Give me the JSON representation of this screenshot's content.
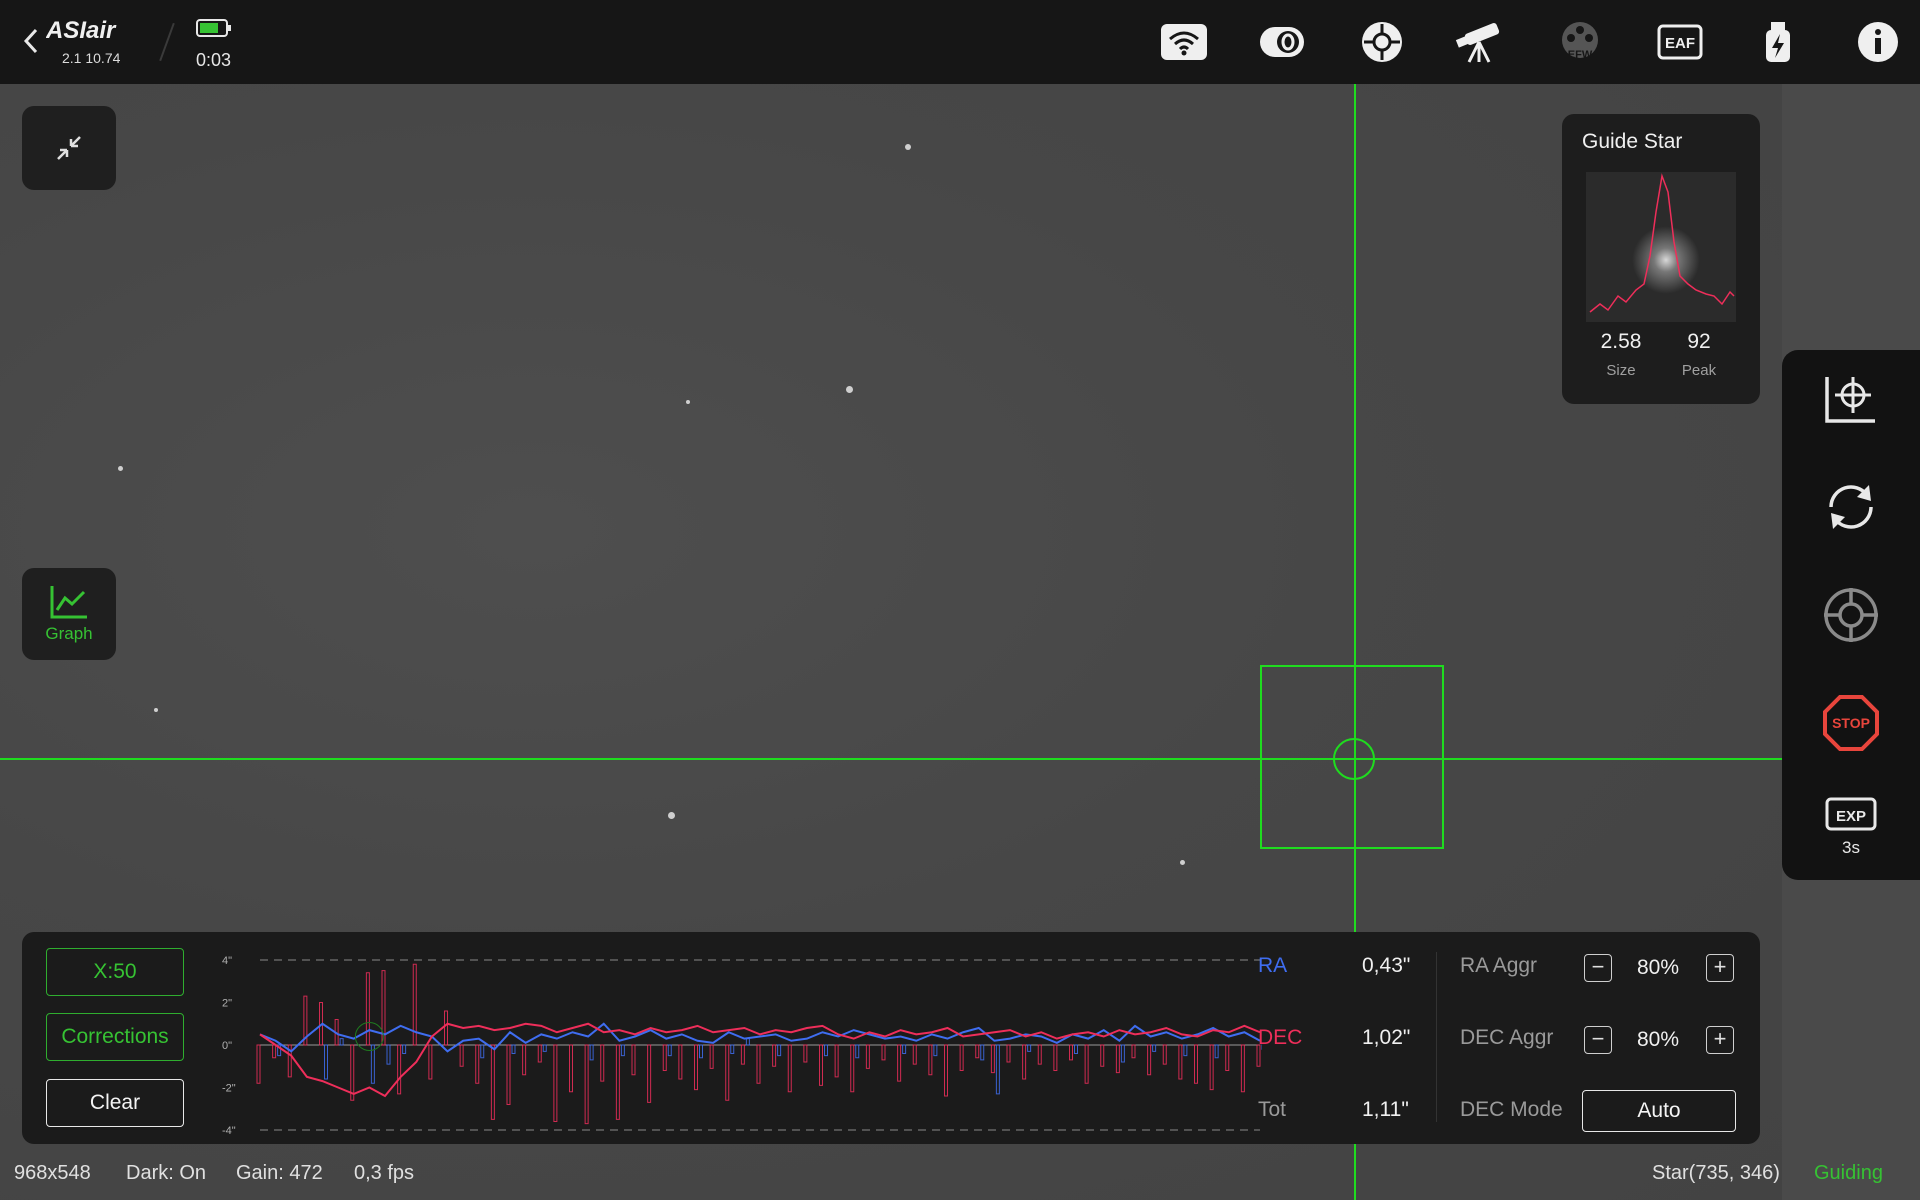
{
  "app": {
    "logo_text": "ASIair",
    "version": "2.1 10.74",
    "elapsed": "0:03",
    "colors": {
      "accent_green": "#36c233",
      "crosshair": "#1fdc1f",
      "ra": "#3f6df0",
      "dec": "#ee2e5a",
      "stop": "#e8453c"
    }
  },
  "toolbar_icons": [
    "wifi-icon",
    "camera-icon",
    "guide-icon",
    "telescope-icon",
    "efw-icon",
    "eaf-icon",
    "usb-power-icon",
    "info-icon"
  ],
  "toolbar_text": {
    "efw": "EFW",
    "eaf": "EAF"
  },
  "left_buttons": {
    "graph_label": "Graph"
  },
  "guide_star": {
    "title": "Guide Star",
    "size_value": "2.58",
    "size_label": "Size",
    "peak_value": "92",
    "peak_label": "Peak"
  },
  "right_toolbar": {
    "stop_label": "STOP",
    "exp_icon_text": "EXP",
    "exposure": "3s"
  },
  "graph_panel": {
    "scale_button": "X:50",
    "corrections_button": "Corrections",
    "clear_button": "Clear",
    "y_ticks": [
      "4\"",
      "2\"",
      "0\"",
      "-2\"",
      "-4\""
    ],
    "ra_label": "RA",
    "ra_value": "0,43\"",
    "dec_label": "DEC",
    "dec_value": "1,02\"",
    "tot_label": "Tot",
    "tot_value": "1,11\"",
    "ra_aggr_label": "RA Aggr",
    "ra_aggr_value": "80%",
    "dec_aggr_label": "DEC Aggr",
    "dec_aggr_value": "80%",
    "dec_mode_label": "DEC Mode",
    "dec_mode_value": "Auto",
    "minus": "−",
    "plus": "+"
  },
  "chart_data": {
    "type": "line",
    "ylim": [
      -4,
      4
    ],
    "series": [
      {
        "name": "RA",
        "values": [
          0.5,
          0.2,
          -0.3,
          0.4,
          1.0,
          0.5,
          0.3,
          0.7,
          0.5,
          0.9,
          0.6,
          0.4,
          -0.3,
          0.2,
          0.3,
          -0.2,
          0.6,
          0.1,
          0.5,
          0.3,
          0.6,
          0.4,
          1.0,
          0.2,
          0.4,
          0.7,
          0.3,
          0.5,
          0.2,
          0.1,
          0.6,
          0.3,
          0.4,
          0.5,
          0.2,
          0.3,
          0.6,
          0.4,
          0.7,
          0.5,
          0.3,
          0.4,
          0.2,
          0.5,
          0.3,
          0.6,
          0.8,
          0.2,
          0.3,
          0.5,
          0.4,
          0.1,
          0.5,
          0.3,
          0.7,
          0.2,
          0.9,
          0.4,
          0.6,
          0.3,
          0.5,
          0.8,
          0.4,
          0.6,
          0.2
        ]
      },
      {
        "name": "DEC",
        "values": [
          0.5,
          0.0,
          -0.5,
          -1.5,
          -1.7,
          -2.0,
          -2.3,
          -2.0,
          -2.4,
          -1.5,
          -0.8,
          0.4,
          1.0,
          0.8,
          0.9,
          0.7,
          0.8,
          1.0,
          0.9,
          0.6,
          0.8,
          1.0,
          0.6,
          0.7,
          0.5,
          0.8,
          0.6,
          0.7,
          0.9,
          0.6,
          0.7,
          0.8,
          0.5,
          0.7,
          0.6,
          0.8,
          0.9,
          0.5,
          0.3,
          0.6,
          0.4,
          0.7,
          0.5,
          0.6,
          0.8,
          0.4,
          0.5,
          0.6,
          0.7,
          0.4,
          0.6,
          0.3,
          0.5,
          0.6,
          0.4,
          0.7,
          0.5,
          0.6,
          0.8,
          0.5,
          0.4,
          0.7,
          0.6,
          0.9,
          0.6
        ]
      }
    ],
    "corrections": {
      "ra": [
        0,
        -0.5,
        0,
        0,
        -1.6,
        0.3,
        0,
        -1.8,
        -0.9,
        -0.4,
        0,
        0,
        0,
        0,
        -0.6,
        0,
        -0.4,
        0,
        -0.3,
        0,
        0,
        -0.7,
        0,
        -0.5,
        0,
        0,
        -0.5,
        0,
        -0.6,
        0,
        -0.4,
        0.3,
        0,
        -0.5,
        0,
        0,
        -0.5,
        0,
        -0.6,
        0,
        0,
        -0.4,
        0,
        -0.5,
        0,
        0,
        -0.7,
        -2.3,
        0,
        -0.3,
        0,
        0,
        -0.4,
        0,
        0,
        -0.8,
        0,
        -0.3,
        0,
        -0.5,
        0,
        -0.6,
        0,
        0,
        -0.2
      ],
      "dec": [
        -1.8,
        -0.6,
        -1.5,
        2.3,
        2.0,
        1.2,
        -2.6,
        3.4,
        3.5,
        -2.3,
        3.8,
        -1.6,
        1.6,
        -1.0,
        -1.8,
        -3.5,
        -2.8,
        -1.4,
        -0.8,
        -3.6,
        -2.2,
        -3.7,
        -1.7,
        -3.5,
        -1.4,
        -2.7,
        -1.2,
        -1.6,
        -2.1,
        -1.1,
        -2.6,
        -0.9,
        -1.8,
        -1.0,
        -2.2,
        -0.8,
        -1.9,
        -1.5,
        -2.2,
        -1.1,
        -0.7,
        -1.7,
        -0.9,
        -1.4,
        -2.4,
        -1.2,
        -0.6,
        -1.3,
        -0.8,
        -1.6,
        -0.9,
        -1.2,
        -0.7,
        -1.8,
        -1.0,
        -1.3,
        -0.6,
        -1.4,
        -0.9,
        -1.6,
        -1.8,
        -2.1,
        -1.2,
        -2.2,
        -1.0
      ]
    }
  },
  "status_bar": {
    "resolution": "968x548",
    "dark": "Dark: On",
    "gain": "Gain: 472",
    "fps": "0,3 fps",
    "star": "Star(735, 346)",
    "state": "Guiding"
  }
}
